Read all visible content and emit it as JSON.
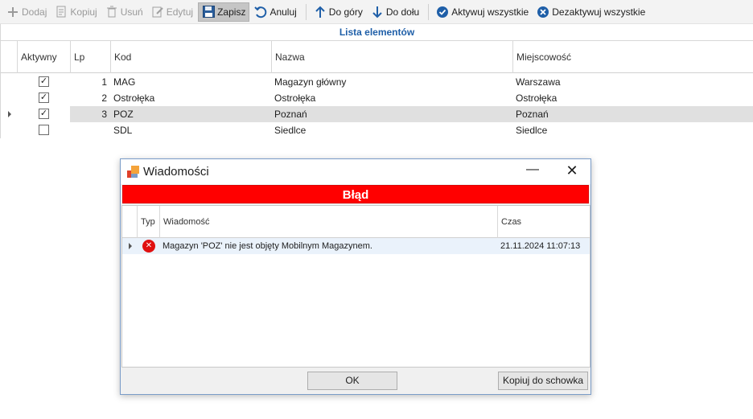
{
  "toolbar": {
    "add": "Dodaj",
    "copy": "Kopiuj",
    "delete": "Usuń",
    "edit": "Edytuj",
    "save": "Zapisz",
    "cancel": "Anuluj",
    "up": "Do góry",
    "down": "Do dołu",
    "activate_all": "Aktywuj wszystkie",
    "deactivate_all": "Dezaktywuj wszystkie"
  },
  "grid": {
    "title": "Lista elementów",
    "columns": {
      "active": "Aktywny",
      "lp": "Lp",
      "code": "Kod",
      "name": "Nazwa",
      "city": "Miejscowość"
    },
    "rows": [
      {
        "active": true,
        "lp": "1",
        "code": "MAG",
        "name": "Magazyn główny",
        "city": "Warszawa"
      },
      {
        "active": true,
        "lp": "2",
        "code": "Ostrołęka",
        "name": "Ostrołęka",
        "city": "Ostrołęka"
      },
      {
        "active": true,
        "lp": "3",
        "code": "POZ",
        "name": "Poznań",
        "city": "Poznań"
      },
      {
        "active": false,
        "lp": "",
        "code": "SDL",
        "name": "Siedlce",
        "city": "Siedlce"
      }
    ]
  },
  "dialog": {
    "title": "Wiadomości",
    "banner": "Błąd",
    "columns": {
      "type": "Typ",
      "message": "Wiadomość",
      "time": "Czas"
    },
    "message": {
      "text": "Magazyn 'POZ' nie jest objęty Mobilnym Magazynem.",
      "time": "21.11.2024 11:07:13"
    },
    "ok_button": "OK",
    "copy_button": "Kopiuj do schowka"
  },
  "colors": {
    "accent": "#1f5fa8",
    "error": "#ff0000",
    "selected_row": "#e0e0e0"
  }
}
